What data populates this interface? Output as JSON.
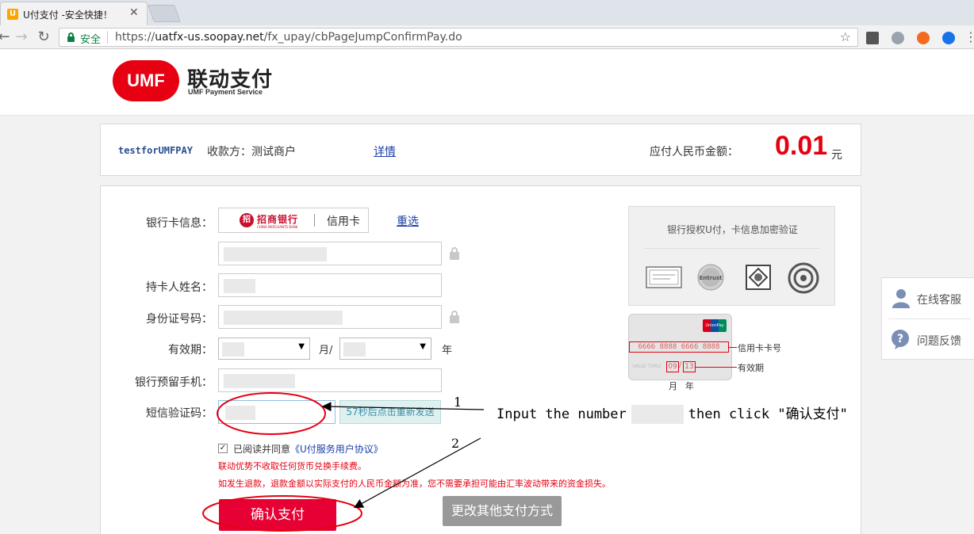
{
  "browser": {
    "tab_title": "U付支付 -安全快捷！",
    "tab_close": "✕",
    "secure_label": "安全",
    "url_scheme": "https://",
    "url_host": "uatfx-us.soopay.net",
    "url_path": "/fx_upay/cbPageJumpConfirmPay.do"
  },
  "header": {
    "logo_mark": "UMF",
    "logo_cn": "联动支付",
    "logo_en": "UMF Payment Service"
  },
  "summary": {
    "merchant_id": "testforUMFPAY",
    "payee": "收款方：测试商户",
    "detail_link": "详情",
    "amount_label": "应付人民币金额：",
    "amount_value": "0.01",
    "amount_unit": "元"
  },
  "form": {
    "card_info_label": "银行卡信息：",
    "bank_name": "招商银行",
    "bank_sub": "CHINA MERCHANTS BANK",
    "card_type": "信用卡",
    "reselect": "重选",
    "holder_label": "持卡人姓名：",
    "id_label": "身份证号码：",
    "expiry_label": "有效期：",
    "month_suffix": "月/",
    "year_suffix": "年",
    "phone_label": "银行预留手机：",
    "sms_label": "短信验证码：",
    "sms_button": "57秒后点击重新发送",
    "agree_prefix": "已阅读并同意",
    "agree_link": "《U付服务用户协议》",
    "notice_1": "联动优势不收取任何货币兑换手续费。",
    "notice_2": "如发生退款，退款金额以实际支付的人民币金额为准，您不需要承担可能由汇率波动带来的资金损失。",
    "confirm_button": "确认支付",
    "other_button": "更改其他支付方式"
  },
  "verify": {
    "title": "银行授权U付，卡信息加密验证"
  },
  "card_sample": {
    "unionpay": "UnionPay",
    "card_number": "6666 8888 6666 8888",
    "card_number_label": "信用卡卡号",
    "valid_thru": "VALID THRU",
    "month": "09",
    "year": "13",
    "valid_label": "有效期",
    "month_label": "月",
    "year_label": "年"
  },
  "service": {
    "online": "在线客服",
    "feedback": "问题反馈"
  },
  "annotation": {
    "step1": "1",
    "step2": "2",
    "text_before": "Input the number",
    "text_after": "then click \"确认支付\""
  },
  "colors": {
    "brand_red": "#e60012",
    "confirm_red": "#e60033",
    "link_blue": "#1a3fa8",
    "secure_green": "#0b8043"
  }
}
